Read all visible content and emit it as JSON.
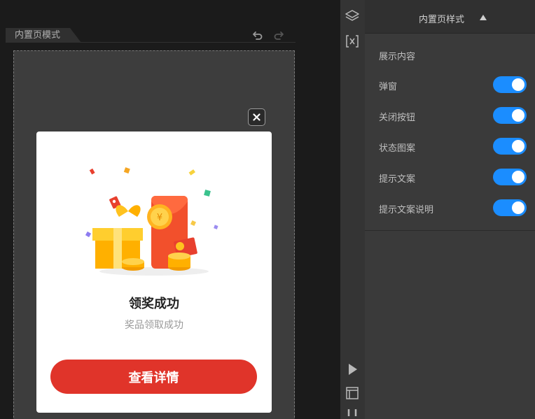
{
  "canvas": {
    "mode_tab_label": "内置页模式"
  },
  "popup": {
    "title": "领奖成功",
    "subtitle": "奖品领取成功",
    "cta_label": "查看详情",
    "illustration_icons": [
      "gift-box-icon",
      "red-envelope-icon",
      "gold-coin-icon",
      "confetti-icon"
    ]
  },
  "icon_strip": {
    "items": [
      "layers-icon",
      "variable-icon",
      "play-icon",
      "frame-icon",
      "magnet-icon"
    ]
  },
  "panel": {
    "title": "内置页样式",
    "section_title": "展示内容",
    "toggles": [
      {
        "label": "弹窗",
        "on": true
      },
      {
        "label": "关闭按钮",
        "on": true
      },
      {
        "label": "状态图案",
        "on": true
      },
      {
        "label": "提示文案",
        "on": true
      },
      {
        "label": "提示文案说明",
        "on": true
      }
    ]
  },
  "colors": {
    "toggle_on": "#1b8dff",
    "cta_red": "#e0342a",
    "panel_bg": "#3a3a3a"
  }
}
